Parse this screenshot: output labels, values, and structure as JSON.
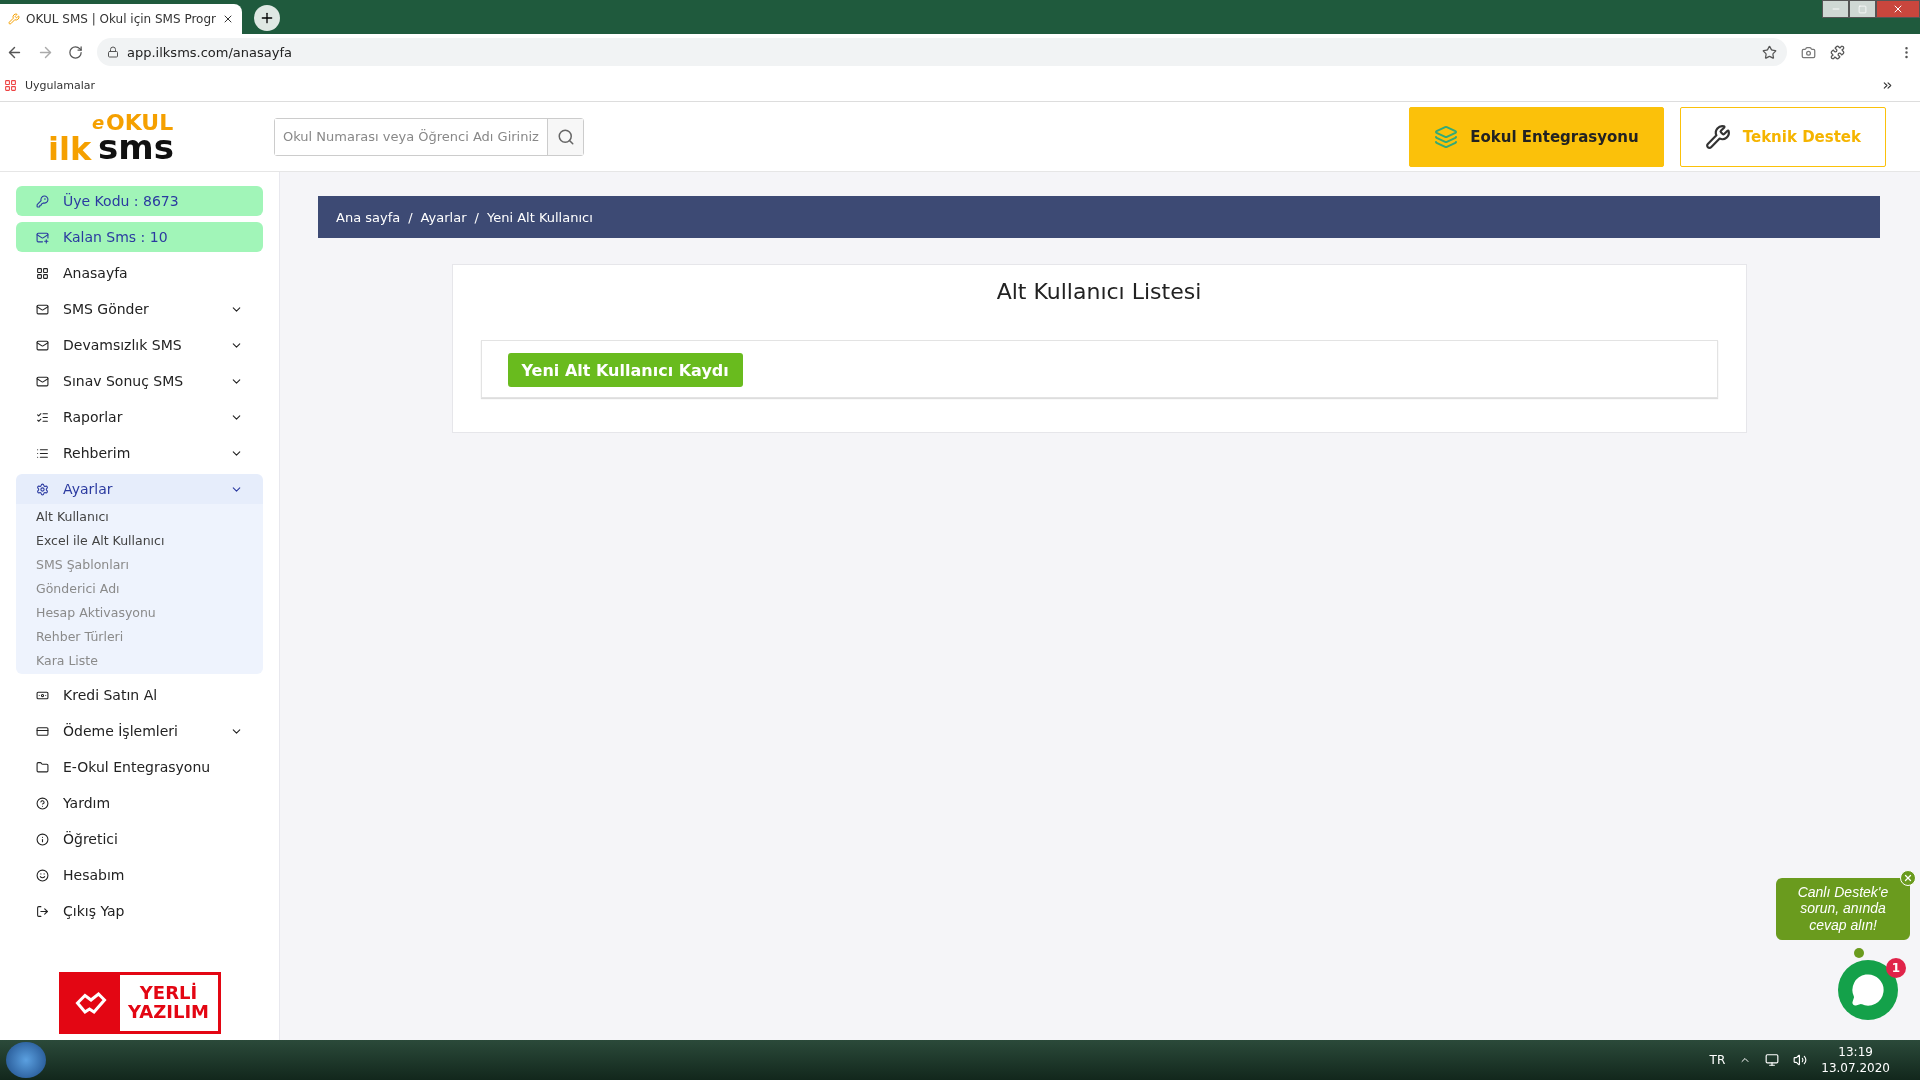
{
  "browser": {
    "tab_title": "OKUL SMS | Okul için SMS Progr",
    "url": "app.ilksms.com/anasayfa",
    "bookmark": "Uygulamalar"
  },
  "logo": {
    "prefix": "e",
    "top": "OKUL",
    "left": "ilk",
    "right": "sms"
  },
  "header": {
    "search": {
      "placeholder": "Okul Numarası veya Öğrenci Adı Giriniz"
    },
    "buttons": [
      {
        "label": "Eokul Entegrasyonu",
        "kind": "filled"
      },
      {
        "label": "Teknik Destek",
        "kind": "outline"
      }
    ]
  },
  "sidebar": {
    "items": [
      {
        "label": "Üye Kodu : 8673",
        "kind": "badge",
        "expandable": false,
        "expanded": false
      },
      {
        "label": "Kalan Sms : 10",
        "kind": "badge",
        "expandable": false,
        "expanded": false
      },
      {
        "label": "Anasayfa",
        "kind": "link",
        "expandable": false,
        "expanded": false
      },
      {
        "label": "SMS Gönder",
        "kind": "link",
        "expandable": true,
        "expanded": false
      },
      {
        "label": "Devamsızlık SMS",
        "kind": "link",
        "expandable": true,
        "expanded": false
      },
      {
        "label": "Sınav Sonuç SMS",
        "kind": "link",
        "expandable": true,
        "expanded": false
      },
      {
        "label": "Raporlar",
        "kind": "link",
        "expandable": true,
        "expanded": false
      },
      {
        "label": "Rehberim",
        "kind": "link",
        "expandable": true,
        "expanded": false
      },
      {
        "label": "Ayarlar",
        "kind": "link",
        "expandable": true,
        "expanded": true,
        "children": [
          {
            "label": "Alt Kullanıcı",
            "dimmed": false
          },
          {
            "label": "Excel ile Alt Kullanıcı",
            "dimmed": false
          },
          {
            "label": "SMS Şablonları",
            "dimmed": true
          },
          {
            "label": "Gönderici Adı",
            "dimmed": true
          },
          {
            "label": "Hesap Aktivasyonu",
            "dimmed": true
          },
          {
            "label": "Rehber Türleri",
            "dimmed": true
          },
          {
            "label": "Kara Liste",
            "dimmed": true
          }
        ]
      },
      {
        "label": "Kredi Satın Al",
        "kind": "link",
        "expandable": false,
        "expanded": false
      },
      {
        "label": "Ödeme İşlemleri",
        "kind": "link",
        "expandable": true,
        "expanded": false
      },
      {
        "label": "E-Okul Entegrasyonu",
        "kind": "link",
        "expandable": false,
        "expanded": false
      },
      {
        "label": "Yardım",
        "kind": "link",
        "expandable": false,
        "expanded": false
      },
      {
        "label": "Öğretici",
        "kind": "link",
        "expandable": false,
        "expanded": false
      },
      {
        "label": "Hesabım",
        "kind": "link",
        "expandable": false,
        "expanded": false
      },
      {
        "label": "Çıkış Yap",
        "kind": "link",
        "expandable": false,
        "expanded": false
      }
    ],
    "badge": {
      "top": "YERLİ",
      "bottom": "YAZILIM"
    }
  },
  "breadcrumb": {
    "separator": "/",
    "items": [
      "Ana sayfa",
      "Ayarlar",
      "Yeni Alt Kullanıcı"
    ]
  },
  "card": {
    "title": "Alt Kullanıcı Listesi",
    "button": "Yeni Alt Kullanıcı Kaydı"
  },
  "chat": {
    "message": "Canlı Destek'e sorun, anında cevap alın!",
    "unread": "1"
  },
  "taskbar": {
    "language": "TR",
    "time": "13:19",
    "date": "13.07.2020"
  }
}
